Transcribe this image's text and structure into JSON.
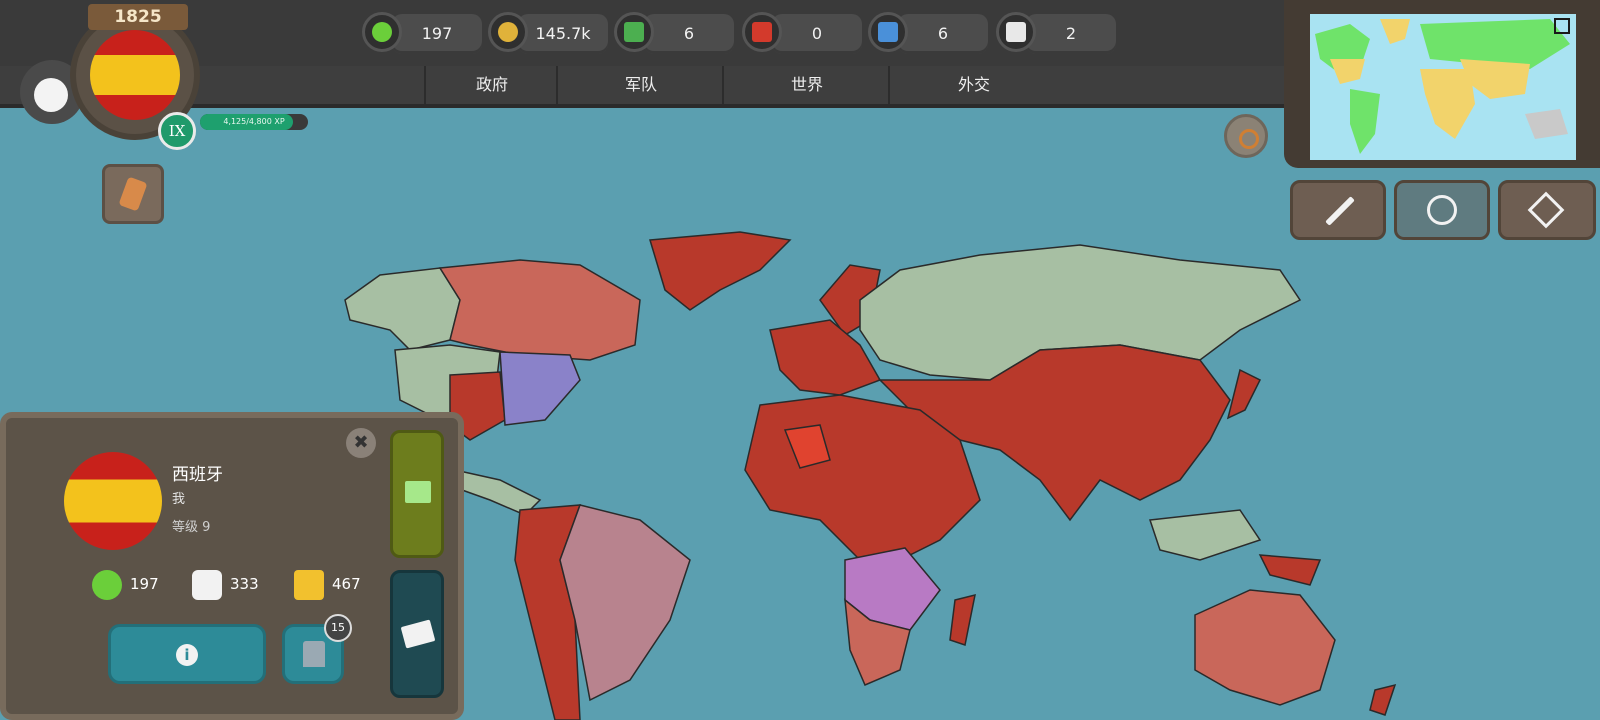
{
  "header": {
    "year": "1825",
    "level_roman": "IX",
    "xp_text": "4,125/4,800 XP",
    "xp_fraction": 0.86
  },
  "resources": [
    {
      "name": "happiness",
      "value": "197",
      "icon": "smiley-icon",
      "color": "#6bcf3a"
    },
    {
      "name": "gold",
      "value": "145.7k",
      "icon": "coins-icon",
      "color": "#e0b23a"
    },
    {
      "name": "green-crowns",
      "value": "6",
      "icon": "green-crown-icon",
      "color": "#4caf50"
    },
    {
      "name": "red-crowns",
      "value": "0",
      "icon": "red-crown-icon",
      "color": "#d33a2c"
    },
    {
      "name": "blue-crowns",
      "value": "6",
      "icon": "blue-crown-icon",
      "color": "#4a90d9"
    },
    {
      "name": "letters",
      "value": "2",
      "icon": "envelope-icon",
      "color": "#e8e8e8"
    }
  ],
  "tabs": [
    "政府",
    "军队",
    "世界",
    "外交"
  ],
  "nation": {
    "name": "西班牙",
    "owner": "我",
    "level": "等级 9",
    "stats": [
      {
        "icon": "smiley-icon",
        "value": "197",
        "color": "#6bcf3a"
      },
      {
        "icon": "dove-icon",
        "value": "333",
        "color": "#f2f2f2"
      },
      {
        "icon": "lightning-icon",
        "value": "467",
        "color": "#f2c12e"
      }
    ],
    "info_symbol": "i",
    "bank_badge": "15",
    "close_symbol": "✖"
  },
  "colors": {
    "ocean": "#5b9fb0",
    "player_red": "#b8392b",
    "ally_salmon": "#c9675a",
    "neutral_green": "#a7bfa3",
    "purple": "#8a82c9",
    "pink": "#b8838e"
  }
}
